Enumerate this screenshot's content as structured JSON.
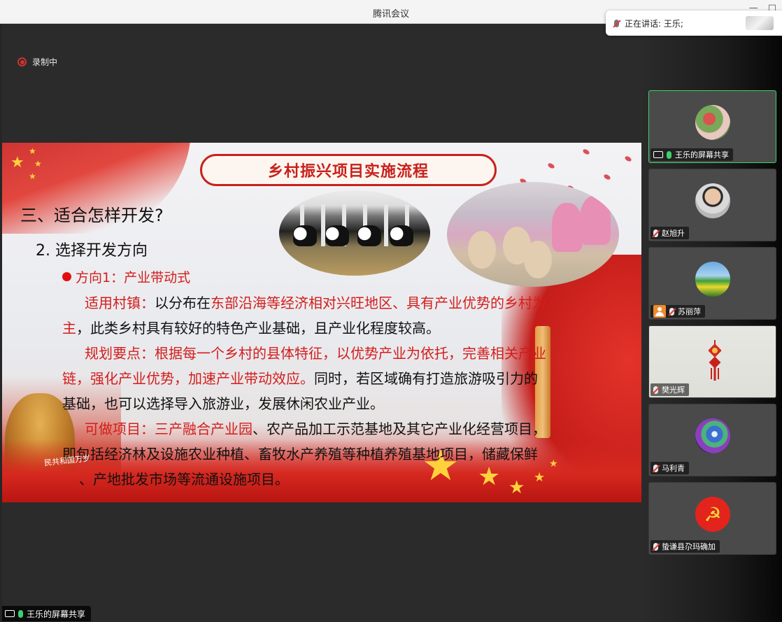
{
  "window": {
    "title": "腾讯会议",
    "controls": [
      "—",
      "□"
    ]
  },
  "recording": {
    "label": "录制中"
  },
  "speaking": {
    "label": "正在讲话: 王乐;"
  },
  "slide": {
    "title": "乡村振兴项目实施流程",
    "heading3": "三、适合怎样开发?",
    "heading2": "2. 选择开发方向",
    "bullet": "方向1：产业带动式",
    "line1": {
      "a": "适用村镇：",
      "b": "以分布在",
      "c": "东部沿海等经济相对兴旺地区、具有产业优势的乡村为"
    },
    "line2": {
      "a": "主",
      "b": "，此类乡村具有较好的特色产业基础，且产业化程度较高。"
    },
    "line3": {
      "a": "规划要点：根据每一个乡村的县体特征，以优势产业为依托，完善相关产业"
    },
    "line4": {
      "a": "链，强化产业优势，加速产业带动效应。",
      "b": "同时，若区域确有打造旅游吸引力的"
    },
    "line5": {
      "a": "基础，也可以选择导入旅游业，发展休闲农业产业。"
    },
    "line6": {
      "a": "可做项目：三产融合产业园",
      "b": "、农产品加工示范基地及其它产业化经营项目，"
    },
    "line7": {
      "a": "即包括经济林及设施农业种植、畜牧水产养殖等种植养殖基地项目，储藏保鲜"
    },
    "line8": {
      "a": "、产地批发市场等流通设施项目。"
    },
    "banner_text": "民共和国万岁"
  },
  "share": {
    "label": "王乐的屏幕共享"
  },
  "participants": [
    {
      "name": "王乐的屏幕共享",
      "mic": "on",
      "icon": "screen-share-icon"
    },
    {
      "name": "赵旭升",
      "mic": "off"
    },
    {
      "name": "苏丽萍",
      "mic": "off",
      "icon": "person-icon"
    },
    {
      "name": "樊光辉",
      "mic": "off"
    },
    {
      "name": "马利青",
      "mic": "off"
    },
    {
      "name": "蛰谦县尕玛确加",
      "mic": "off"
    }
  ],
  "colors": {
    "accent_green": "#3bd36a",
    "slide_red": "#d41d1b",
    "record_red": "#c9342f"
  }
}
